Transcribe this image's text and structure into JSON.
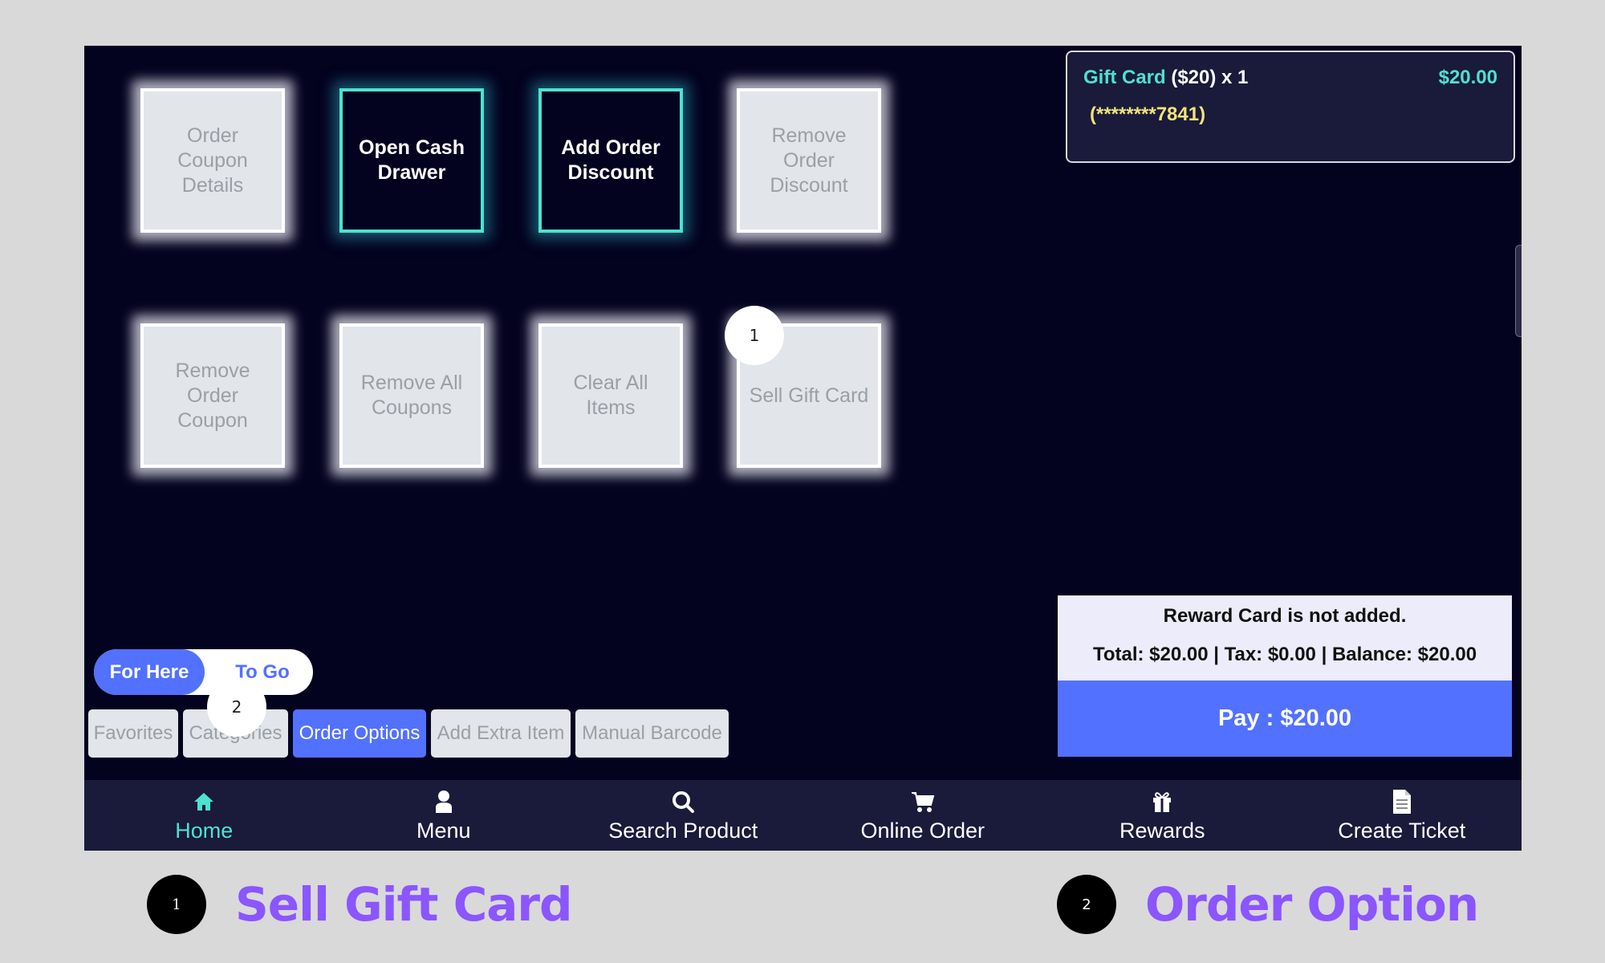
{
  "option_tiles": [
    {
      "label": "Order Coupon Details",
      "state": "disabled"
    },
    {
      "label": "Open Cash Drawer",
      "state": "active"
    },
    {
      "label": "Add Order Discount",
      "state": "active"
    },
    {
      "label": "Remove Order Discount",
      "state": "disabled"
    },
    {
      "label": "Remove Order Coupon",
      "state": "disabled"
    },
    {
      "label": "Remove All Coupons",
      "state": "disabled"
    },
    {
      "label": "Clear All Items",
      "state": "disabled"
    },
    {
      "label": "Sell Gift Card",
      "state": "disabled"
    }
  ],
  "markers": {
    "tile_marker": "1",
    "tab_marker": "2"
  },
  "cart": {
    "item_name": "Gift Card",
    "item_detail": " ($20) x 1",
    "item_price": "$20.00",
    "item_serial": "(********7841)"
  },
  "summary": {
    "reward_status": "Reward Card is not added.",
    "totals": "Total: $20.00 | Tax: $0.00 | Balance: $20.00",
    "pay_label": "Pay : $20.00"
  },
  "order_type": {
    "options": [
      "For Here",
      "To Go"
    ],
    "selected": "For Here"
  },
  "tabs": [
    {
      "label": "Favorites",
      "selected": false
    },
    {
      "label": "Categories",
      "selected": false
    },
    {
      "label": "Order Options",
      "selected": true
    },
    {
      "label": "Add Extra Item",
      "selected": false
    },
    {
      "label": "Manual Barcode",
      "selected": false
    }
  ],
  "nav": [
    {
      "label": "Home",
      "icon": "home-icon",
      "active": true
    },
    {
      "label": "Menu",
      "icon": "user-icon",
      "active": false
    },
    {
      "label": "Search Product",
      "icon": "search-icon",
      "active": false
    },
    {
      "label": "Online Order",
      "icon": "cart-icon",
      "active": false
    },
    {
      "label": "Rewards",
      "icon": "gift-icon",
      "active": false
    },
    {
      "label": "Create Ticket",
      "icon": "document-icon",
      "active": false
    }
  ],
  "colors": {
    "accent": "#5271ff",
    "teal": "#4be3cf",
    "caption": "#8b55ff",
    "background": "#03021f"
  },
  "captions": [
    {
      "number": "1",
      "text": "Sell Gift Card"
    },
    {
      "number": "2",
      "text": "Order Option"
    }
  ]
}
